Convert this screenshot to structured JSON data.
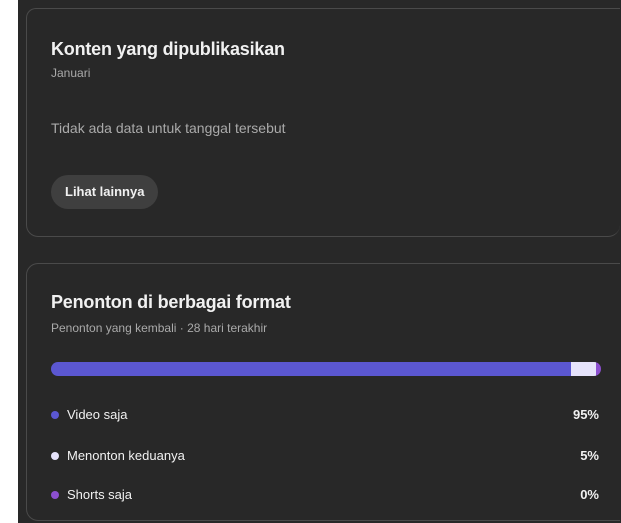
{
  "published_card": {
    "title": "Konten yang dipublikasikan",
    "subtitle": "Januari",
    "empty_message": "Tidak ada data untuk tanggal tersebut",
    "see_more_label": "Lihat lainnya"
  },
  "viewers_card": {
    "title": "Penonton di berbagai format",
    "subtitle": "Penonton yang kembali · 28 hari terakhir",
    "colors": {
      "video": "#5b57d1",
      "both": "#e6e3fb",
      "shorts": "#8c4fcf"
    },
    "formats": [
      {
        "label": "Video saja",
        "value": "95%",
        "share": 0.95,
        "color": "#5b57d1"
      },
      {
        "label": "Menonton keduanya",
        "value": "5%",
        "share": 0.045,
        "color": "#e6e3fb"
      },
      {
        "label": "Shorts saja",
        "value": "0%",
        "share": 0.01,
        "color": "#8c4fcf"
      }
    ]
  }
}
